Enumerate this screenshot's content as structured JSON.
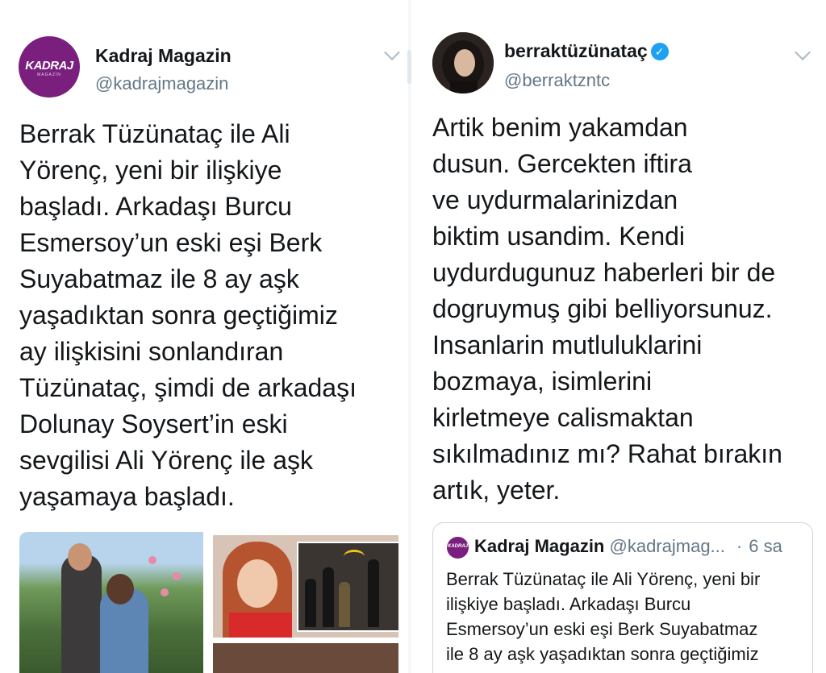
{
  "left_tweet": {
    "avatar_text": "KADRAJ",
    "avatar_subtext": "MAGAZİN",
    "display_name": "Kadraj Magazin",
    "handle": "@kadrajmagazin",
    "text_lines": [
      "Berrak Tüzünataç ile Ali",
      "Yörenç, yeni bir ilişkiye",
      "başladı. Arkadaşı Burcu",
      "Esmersoy’un eski eşi Berk",
      "Suyabatmaz ile 8 ay aşk",
      "yaşadıktan sonra geçtiğimiz",
      "ay ilişkisini sonlandıran",
      "Tüzünataç, şimdi de arkadaşı",
      "Dolunay Soysert’in eski",
      "sevgilisi Ali Yörenç ile aşk",
      "yaşamaya başladı."
    ],
    "icons": [
      "chevron-down-icon"
    ]
  },
  "right_tweet": {
    "display_name": "berraktüzünataç",
    "verified_mark": "✓",
    "handle": "@berraktzntc",
    "text_lines": [
      "Artik benim yakamdan",
      "dusun. Gercekten iftira",
      "ve uydurmalarinizdan",
      "biktim usandim. Kendi",
      "uydurdugunuz haberleri bir de",
      "dogruymuş gibi belliyorsunuz.",
      "Insanlarin mutluluklarini",
      "bozmaya, isimlerini",
      "kirletmeye calismaktan",
      "sıkılmadınız mı? Rahat bırakın",
      "artık, yeter."
    ],
    "quoted": {
      "avatar_text": "KADRAJ",
      "display_name": "Kadraj Magazin",
      "handle": "@kadrajmag...",
      "separator": "·",
      "time": "6 sa",
      "text_lines": [
        "Berrak Tüzünataç ile Ali Yörenç, yeni bir",
        "ilişkiye başladı. Arkadaşı Burcu",
        "Esmersoy’un eski eşi Berk Suyabatmaz",
        "ile 8 ay aşk yaşadıktan sonra geçtiğimiz"
      ]
    }
  },
  "colors": {
    "name": "#14171a",
    "handle": "#657786",
    "verified": "#1da1f2",
    "kadraj_purple": "#7a1f7e",
    "border": "#ccd6dd"
  }
}
